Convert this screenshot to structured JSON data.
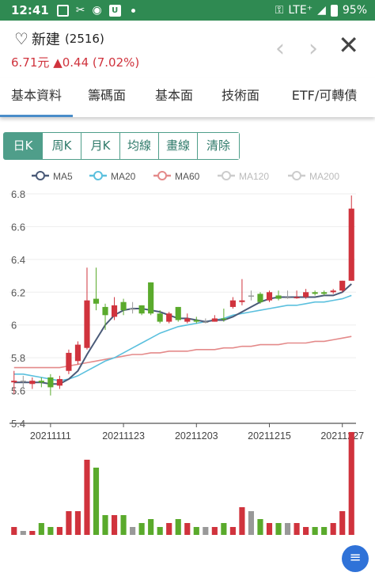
{
  "status": {
    "time": "12:41",
    "network": "LTE⁺",
    "battery": "95%"
  },
  "stock": {
    "name": "新建",
    "code": "(2516)",
    "price": "6.71元",
    "change": "▲0.44 (7.02%)"
  },
  "tabs": [
    "基本資料",
    "籌碼面",
    "基本面",
    "技術面",
    "ETF/可轉債"
  ],
  "periods": [
    "日K",
    "周K",
    "月K",
    "均線",
    "畫線",
    "清除"
  ],
  "colors": {
    "up": "#d0333d",
    "down": "#5aaa2c",
    "flat": "#999999",
    "ma5": "#4a5a78",
    "ma20": "#5bc0de",
    "ma60": "#e48a8a"
  },
  "chart_data": {
    "type": "candlestick",
    "legend": [
      {
        "name": "MA5",
        "color": "#4a5a78",
        "active": true
      },
      {
        "name": "MA20",
        "color": "#5bc0de",
        "active": true
      },
      {
        "name": "MA60",
        "color": "#e48a8a",
        "active": true
      },
      {
        "name": "MA120",
        "color": "#cccccc",
        "active": false
      },
      {
        "name": "MA200",
        "color": "#cccccc",
        "active": false
      }
    ],
    "ylim": [
      5.4,
      6.8
    ],
    "yticks": [
      "5.4",
      "5.6",
      "5.8",
      "6",
      "6.2",
      "6.4",
      "6.6",
      "6.8"
    ],
    "xticks": [
      {
        "label": "20211111",
        "index": 4
      },
      {
        "label": "20211123",
        "index": 12
      },
      {
        "label": "20211203",
        "index": 20
      },
      {
        "label": "20211215",
        "index": 28
      },
      {
        "label": "20211227",
        "index": 36
      }
    ],
    "candles": [
      [
        5.66,
        5.65,
        5.72,
        5.58,
        "u"
      ],
      [
        5.66,
        5.66,
        5.69,
        5.62,
        "f"
      ],
      [
        5.64,
        5.66,
        5.68,
        5.61,
        "u"
      ],
      [
        5.66,
        5.65,
        5.68,
        5.62,
        "d"
      ],
      [
        5.68,
        5.62,
        5.7,
        5.57,
        "d"
      ],
      [
        5.63,
        5.67,
        5.69,
        5.61,
        "u"
      ],
      [
        5.72,
        5.83,
        5.85,
        5.7,
        "u"
      ],
      [
        5.78,
        5.88,
        5.9,
        5.76,
        "u"
      ],
      [
        5.86,
        6.15,
        6.35,
        5.85,
        "u"
      ],
      [
        6.16,
        6.13,
        6.35,
        6.09,
        "d"
      ],
      [
        6.11,
        6.06,
        6.13,
        5.97,
        "d"
      ],
      [
        6.05,
        6.12,
        6.17,
        6.03,
        "u"
      ],
      [
        6.14,
        6.09,
        6.16,
        6.06,
        "d"
      ],
      [
        6.1,
        6.1,
        6.14,
        6.07,
        "f"
      ],
      [
        6.12,
        6.07,
        6.12,
        6.06,
        "d"
      ],
      [
        6.26,
        6.07,
        6.26,
        6.06,
        "d"
      ],
      [
        6.07,
        6.02,
        6.09,
        6.01,
        "d"
      ],
      [
        6.02,
        6.07,
        6.08,
        6.01,
        "u"
      ],
      [
        6.11,
        6.03,
        6.11,
        6.02,
        "d"
      ],
      [
        6.02,
        6.04,
        6.07,
        6.01,
        "u"
      ],
      [
        6.03,
        6.02,
        6.05,
        6.01,
        "d"
      ],
      [
        6.02,
        6.02,
        6.04,
        6.01,
        "f"
      ],
      [
        6.02,
        6.04,
        6.06,
        6.02,
        "u"
      ],
      [
        6.04,
        6.04,
        6.1,
        6.02,
        "d"
      ],
      [
        6.11,
        6.15,
        6.17,
        6.1,
        "u"
      ],
      [
        6.14,
        6.15,
        6.28,
        6.12,
        "u"
      ],
      [
        6.18,
        6.18,
        6.21,
        6.15,
        "f"
      ],
      [
        6.19,
        6.14,
        6.2,
        6.13,
        "d"
      ],
      [
        6.15,
        6.2,
        6.21,
        6.14,
        "u"
      ],
      [
        6.18,
        6.16,
        6.21,
        6.15,
        "d"
      ],
      [
        6.17,
        6.17,
        6.21,
        6.16,
        "f"
      ],
      [
        6.17,
        6.17,
        6.21,
        6.16,
        "u"
      ],
      [
        6.17,
        6.2,
        6.22,
        6.16,
        "u"
      ],
      [
        6.2,
        6.19,
        6.21,
        6.18,
        "d"
      ],
      [
        6.2,
        6.19,
        6.21,
        6.18,
        "d"
      ],
      [
        6.2,
        6.21,
        6.22,
        6.19,
        "u"
      ],
      [
        6.21,
        6.27,
        6.27,
        6.2,
        "u"
      ],
      [
        6.27,
        6.71,
        6.79,
        6.27,
        "u"
      ]
    ],
    "ma5": [
      5.65,
      5.65,
      5.65,
      5.65,
      5.64,
      5.64,
      5.67,
      5.72,
      5.82,
      5.91,
      6.0,
      6.06,
      6.09,
      6.1,
      6.1,
      6.09,
      6.08,
      6.06,
      6.04,
      6.04,
      6.03,
      6.02,
      6.03,
      6.03,
      6.05,
      6.08,
      6.11,
      6.14,
      6.16,
      6.17,
      6.17,
      6.17,
      6.17,
      6.17,
      6.18,
      6.18,
      6.2,
      6.25
    ],
    "ma20": [
      5.7,
      5.7,
      5.69,
      5.68,
      5.67,
      5.66,
      5.67,
      5.69,
      5.72,
      5.75,
      5.78,
      5.8,
      5.83,
      5.86,
      5.89,
      5.92,
      5.95,
      5.97,
      5.99,
      6.0,
      6.01,
      6.02,
      6.03,
      6.04,
      6.06,
      6.07,
      6.08,
      6.09,
      6.1,
      6.11,
      6.12,
      6.12,
      6.13,
      6.14,
      6.14,
      6.15,
      6.16,
      6.18
    ],
    "ma60": [
      5.74,
      5.74,
      5.74,
      5.74,
      5.74,
      5.74,
      5.75,
      5.76,
      5.77,
      5.78,
      5.79,
      5.8,
      5.81,
      5.82,
      5.82,
      5.83,
      5.83,
      5.84,
      5.84,
      5.84,
      5.85,
      5.85,
      5.85,
      5.86,
      5.86,
      5.87,
      5.87,
      5.88,
      5.88,
      5.88,
      5.89,
      5.89,
      5.89,
      5.9,
      5.9,
      5.91,
      5.92,
      5.93
    ],
    "volume": [
      2,
      1,
      1,
      3,
      2,
      2,
      6,
      6,
      19,
      17,
      5,
      5,
      5,
      2,
      3,
      4,
      2,
      3,
      4,
      3,
      2,
      2,
      2,
      3,
      2,
      7,
      6,
      4,
      3,
      3,
      3,
      3,
      2,
      2,
      2,
      3,
      6,
      26
    ]
  }
}
